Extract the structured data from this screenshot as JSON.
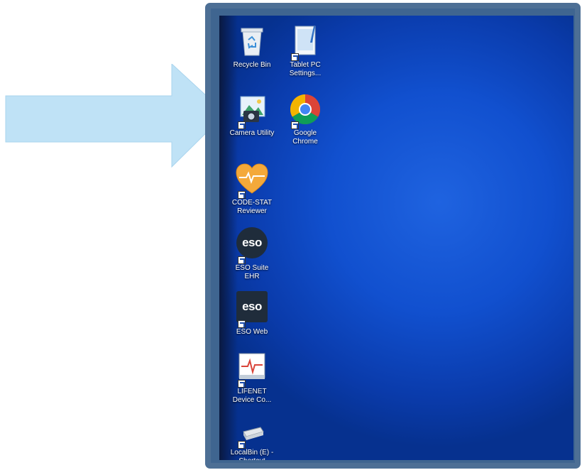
{
  "arrow": {
    "color": "#bfe2f6"
  },
  "screen": {
    "accent": "#1f63e0",
    "icons": [
      {
        "name": "recycle-bin-icon",
        "label": "Recycle Bin"
      },
      {
        "name": "tablet-pc-settings-icon",
        "label": "Tablet PC\nSettings..."
      },
      {
        "name": "camera-utility-icon",
        "label": "Camera Utility"
      },
      {
        "name": "google-chrome-icon",
        "label": "Google\nChrome"
      },
      {
        "name": "code-stat-reviewer-icon",
        "label": "CODE-STAT\nReviewer"
      },
      {
        "name": "eso-suite-ehr-icon",
        "label": "ESO Suite\nEHR",
        "badge": "eso"
      },
      {
        "name": "eso-web-icon",
        "label": "ESO Web",
        "badge": "eso"
      },
      {
        "name": "lifenet-device-icon",
        "label": "LIFENET\nDevice Co..."
      },
      {
        "name": "localbin-shortcut-icon",
        "label": "LocalBin (E) -\nShortcut"
      }
    ]
  }
}
